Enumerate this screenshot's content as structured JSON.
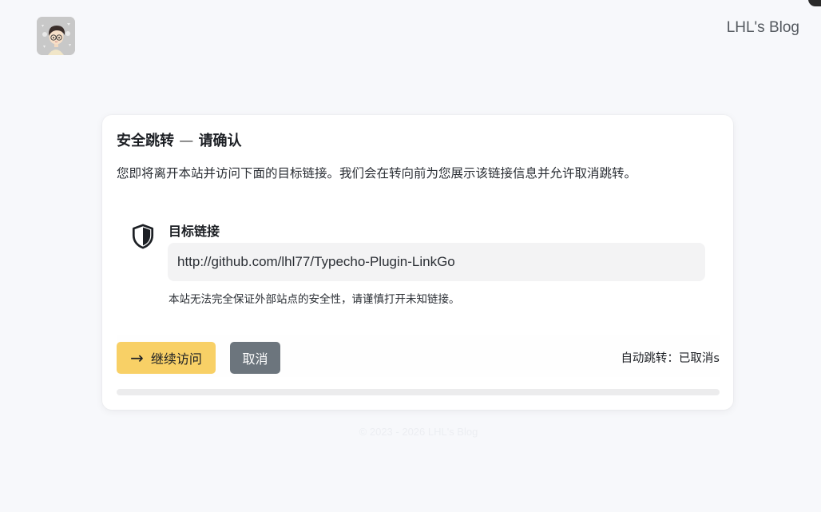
{
  "header": {
    "site_title": "LHL's Blog",
    "avatar_icon": "cartoon-avatar"
  },
  "card": {
    "title_main": "安全跳转",
    "title_sep": "—",
    "title_confirm": "请确认",
    "intro": "您即将离开本站并访问下面的目标链接。我们会在转向前为您展示该链接信息并允许取消跳转。",
    "target_label": "目标链接",
    "target_url": "http://github.com/lhl77/Typecho-Plugin-LinkGo",
    "warning": "本站无法完全保证外部站点的安全性，请谨慎打开未知链接。",
    "continue_label": "继续访问",
    "cancel_label": "取消",
    "auto_redirect": "自动跳转：已取消s",
    "progress_fraction": 0
  },
  "footer": {
    "copyright": "© 2023 - 2026 LHL's Blog"
  },
  "colors": {
    "page_bg": "#f7f8fb",
    "accent": "#f8d066",
    "cancel_bg": "#6c757d",
    "url_bg": "#f3f3f4"
  }
}
